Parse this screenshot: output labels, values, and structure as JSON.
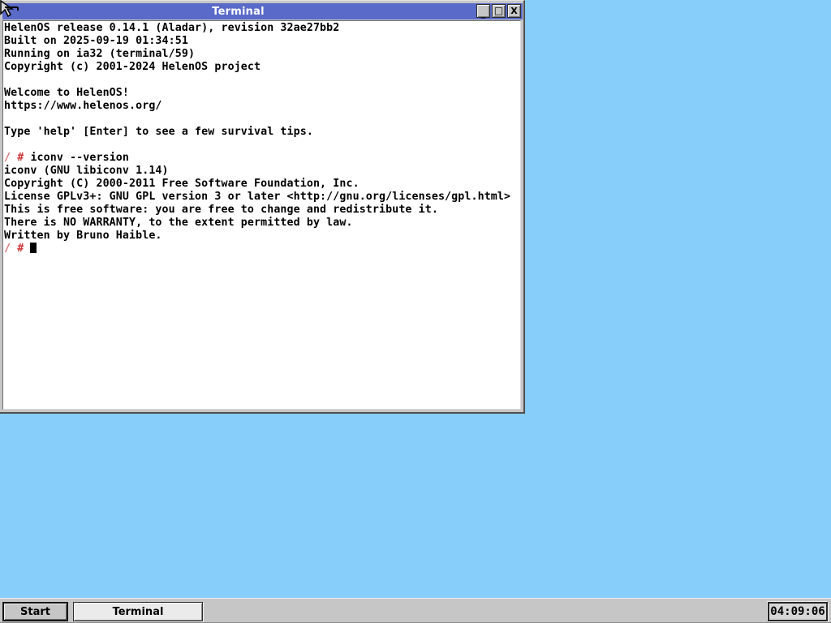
{
  "window": {
    "title": "Terminal",
    "controls": {
      "minimize": "_",
      "maximize": "□",
      "close": "X"
    }
  },
  "terminal": {
    "prompt": {
      "path": "/",
      "symbol": "#"
    },
    "colors": {
      "prompt_path": "#E07070",
      "prompt_symbol": "#CC3333",
      "text": "#000000",
      "background": "#FFFFFF"
    },
    "lines": [
      {
        "type": "output",
        "text": "HelenOS release 0.14.1 (Aladar), revision 32ae27bb2"
      },
      {
        "type": "output",
        "text": "Built on 2025-09-19 01:34:51"
      },
      {
        "type": "output",
        "text": "Running on ia32 (terminal/59)"
      },
      {
        "type": "output",
        "text": "Copyright (c) 2001-2024 HelenOS project"
      },
      {
        "type": "output",
        "text": ""
      },
      {
        "type": "output",
        "text": "Welcome to HelenOS!"
      },
      {
        "type": "output",
        "text": "https://www.helenos.org/"
      },
      {
        "type": "output",
        "text": ""
      },
      {
        "type": "output",
        "text": "Type 'help' [Enter] to see a few survival tips."
      },
      {
        "type": "output",
        "text": ""
      },
      {
        "type": "prompt",
        "command": "iconv --version"
      },
      {
        "type": "output",
        "text": "iconv (GNU libiconv 1.14)"
      },
      {
        "type": "output",
        "text": "Copyright (C) 2000-2011 Free Software Foundation, Inc."
      },
      {
        "type": "output",
        "text": "License GPLv3+: GNU GPL version 3 or later <http://gnu.org/licenses/gpl.html>"
      },
      {
        "type": "output",
        "text": "This is free software: you are free to change and redistribute it."
      },
      {
        "type": "output",
        "text": "There is NO WARRANTY, to the extent permitted by law."
      },
      {
        "type": "output",
        "text": "Written by Bruno Haible."
      },
      {
        "type": "prompt",
        "command": "",
        "cursor": true
      }
    ]
  },
  "taskbar": {
    "start_label": "Start",
    "window_buttons": [
      {
        "label": "Terminal"
      }
    ],
    "clock": "04:09:06"
  },
  "colors": {
    "desktop": "#87CEFA",
    "titlebar": "#5A6AC8",
    "frame": "#C6C6C6"
  }
}
